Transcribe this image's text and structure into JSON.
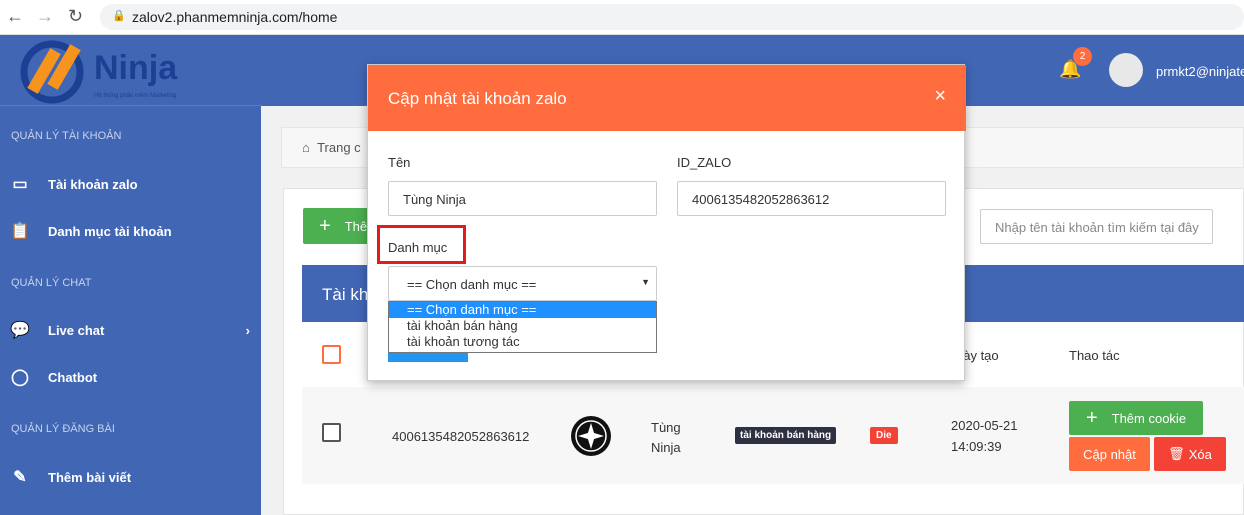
{
  "browser": {
    "url": "zalov2.phanmemninja.com/home"
  },
  "logo": {
    "name": "Ninja",
    "tagline": "Hệ thống phần mềm Marketing"
  },
  "header": {
    "notif_count": "2",
    "user": "prmkt2@ninjate"
  },
  "sidebar": {
    "sections": [
      {
        "title": "QUẢN LÝ TÀI KHOẢN",
        "items": [
          {
            "label": "Tài khoản zalo",
            "icon": "id-card-icon"
          },
          {
            "label": "Danh mục tài khoản",
            "icon": "clipboard-icon"
          }
        ]
      },
      {
        "title": "QUẢN LÝ CHAT",
        "items": [
          {
            "label": "Live chat",
            "icon": "comments-icon"
          },
          {
            "label": "Chatbot",
            "icon": "comment-icon"
          }
        ]
      },
      {
        "title": "QUẢN LÝ ĐĂNG BÀI",
        "items": [
          {
            "label": "Thêm bài viết",
            "icon": "edit-icon"
          }
        ]
      }
    ]
  },
  "breadcrumb": "Trang c",
  "main": {
    "add_label": "Thê",
    "search_placeholder": "Nhập tên tài khoản tìm kiếm tại đây",
    "table_title": "Tài kh",
    "columns": {
      "created": "gày tạo",
      "actions": "Thao tác"
    },
    "row": {
      "id": "4006135482052863612",
      "name": "Tùng Ninja",
      "category": "tài khoản bán hàng",
      "status": "Die",
      "date": "2020-05-21",
      "time": "14:09:39",
      "add_cookie": "Thêm cookie",
      "update": "Cập nhật",
      "delete": "Xóa"
    }
  },
  "modal": {
    "title": "Cập nhật tài khoản zalo",
    "close": "×",
    "name_label": "Tên",
    "name_value": "Tùng Ninja",
    "id_label": "ID_ZALO",
    "id_value": "4006135482052863612",
    "category_label": "Danh mục",
    "category_selected": "== Chọn danh mục ==",
    "options": [
      "== Chọn danh mục ==",
      "tài khoản bán hàng",
      "tài khoản tương tác"
    ]
  },
  "colors": {
    "sidebar": "#4166b4",
    "modal_header": "#ff6d3f",
    "green": "#4caf50",
    "red": "#f44336",
    "highlight": "#e31b1b"
  }
}
